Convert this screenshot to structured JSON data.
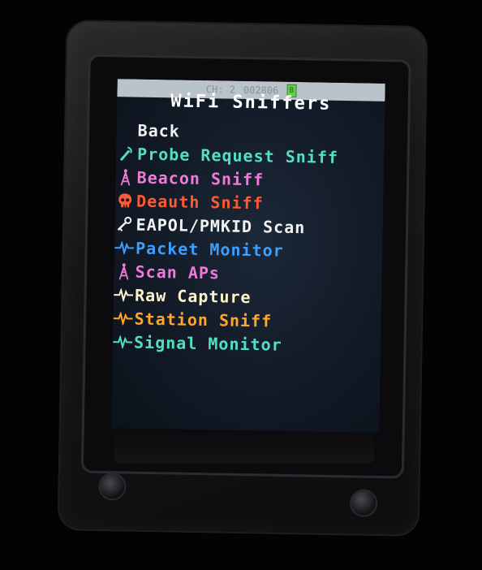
{
  "status_bar": {
    "channel": "CH: 2",
    "counter": "002806",
    "battery_glyph": "B"
  },
  "screen": {
    "title": "WiFi Sniffers"
  },
  "menu": {
    "items": [
      {
        "label": "Back",
        "color": "#f2f2f2",
        "icon": "none"
      },
      {
        "label": "Probe Request Sniff",
        "color": "#52e0c4",
        "icon": "probe-wand-icon"
      },
      {
        "label": "Beacon Sniff",
        "color": "#f07ad8",
        "icon": "tower-icon"
      },
      {
        "label": "Deauth Sniff",
        "color": "#ff5a33",
        "icon": "skull-icon"
      },
      {
        "label": "EAPOL/PMKID Scan",
        "color": "#f2f2f2",
        "icon": "key-icon"
      },
      {
        "label": "Packet Monitor",
        "color": "#3aa0ff",
        "icon": "pulse-icon"
      },
      {
        "label": "Scan APs",
        "color": "#f07ad8",
        "icon": "tower-icon"
      },
      {
        "label": "Raw Capture",
        "color": "#fff5cc",
        "icon": "pulse-icon"
      },
      {
        "label": "Station Sniff",
        "color": "#ffa62b",
        "icon": "pulse-icon"
      },
      {
        "label": "Signal Monitor",
        "color": "#52e0c4",
        "icon": "pulse-icon"
      }
    ]
  }
}
